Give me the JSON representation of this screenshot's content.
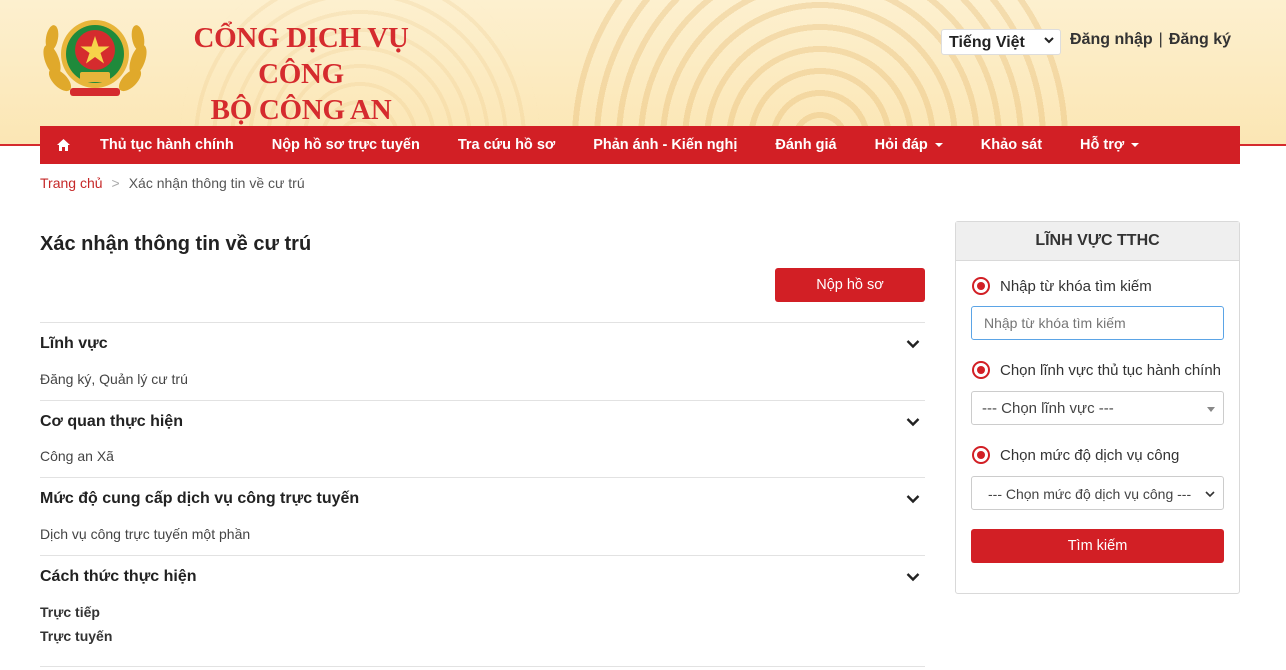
{
  "header": {
    "title_line1": "CỔNG DỊCH VỤ CÔNG",
    "title_line2": "BỘ CÔNG AN",
    "language": "Tiếng Việt",
    "login": "Đăng nhập",
    "separator": "|",
    "register": "Đăng ký",
    "logo_icon": "police-emblem-icon"
  },
  "nav": {
    "home_icon": "home-icon",
    "items": [
      {
        "label": "Thủ tục hành chính",
        "dropdown": false
      },
      {
        "label": "Nộp hồ sơ trực tuyến",
        "dropdown": false
      },
      {
        "label": "Tra cứu hồ sơ",
        "dropdown": false
      },
      {
        "label": "Phản ánh - Kiến nghị",
        "dropdown": false
      },
      {
        "label": "Đánh giá",
        "dropdown": false
      },
      {
        "label": "Hỏi đáp",
        "dropdown": true
      },
      {
        "label": "Khảo sát",
        "dropdown": false
      },
      {
        "label": "Hỗ trợ",
        "dropdown": true
      }
    ]
  },
  "breadcrumb": {
    "home": "Trang chủ",
    "separator": ">",
    "current": "Xác nhận thông tin về cư trú"
  },
  "main": {
    "title": "Xác nhận thông tin về cư trú",
    "submit_label": "Nộp hồ sơ",
    "sections": [
      {
        "title": "Lĩnh vực",
        "values": [
          "Đăng ký, Quản lý cư trú"
        ]
      },
      {
        "title": "Cơ quan thực hiện",
        "values": [
          "Công an Xã"
        ]
      },
      {
        "title": "Mức độ cung cấp dịch vụ công trực tuyến",
        "values": [
          "Dịch vụ công trực tuyến một phần"
        ]
      },
      {
        "title": "Cách thức thực hiện",
        "values": [
          "Trực tiếp",
          "Trực tuyến"
        ]
      }
    ]
  },
  "sidebar": {
    "title": "LĨNH VỰC TTHC",
    "keyword_label": "Nhập từ khóa tìm kiếm",
    "keyword_placeholder": "Nhập từ khóa tìm kiếm",
    "field_label": "Chọn lĩnh vực thủ tục hành chính",
    "field_select": "--- Chọn lĩnh vực ---",
    "level_label": "Chọn mức độ dịch vụ công",
    "level_select": "--- Chọn mức độ dịch vụ công ---",
    "search_label": "Tìm kiếm"
  },
  "colors": {
    "brand_red": "#d21f25",
    "header_bg": "#fbe6b4",
    "input_focus": "#5ba4e6"
  }
}
